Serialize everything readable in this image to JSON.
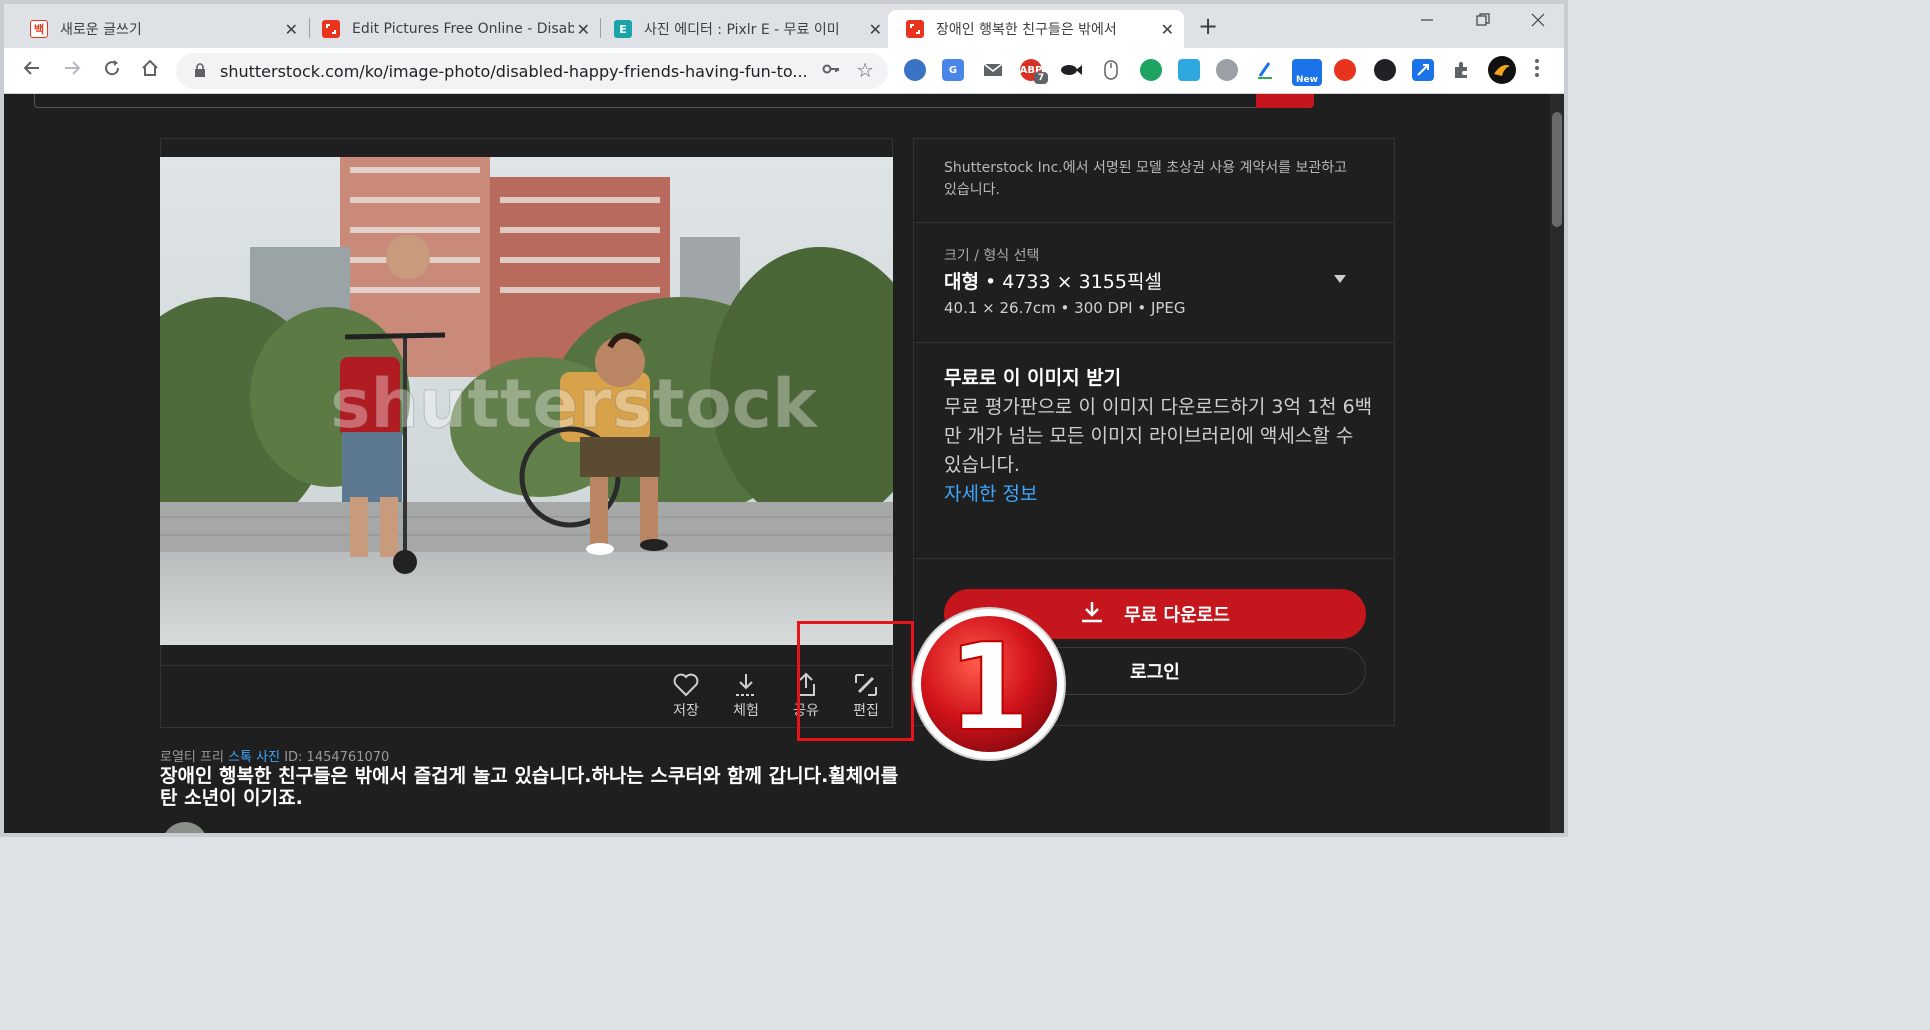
{
  "browser": {
    "tabs": [
      {
        "title": "새로운 글쓰기",
        "favicon_text": "백",
        "favicon_color": "#e8341c"
      },
      {
        "title": "Edit Pictures Free Online - Disab",
        "favicon_text": "",
        "favicon_color": "#e8341c"
      },
      {
        "title": "사진 에디터 : Pixlr E - 무료 이미",
        "favicon_text": "E",
        "favicon_color": "#1aa3a8"
      },
      {
        "title": "장애인 행복한 친구들은 밖에서",
        "favicon_text": "",
        "favicon_color": "#e8341c"
      }
    ],
    "close_glyph": "✕",
    "new_tab_glyph": "+",
    "url": "shutterstock.com/ko/image-photo/disabled-happy-friends-having-fun-to...",
    "extension_badges": {
      "abp_count": "7",
      "new_label": "New"
    }
  },
  "photo": {
    "watermark": "shutterstock"
  },
  "actions": [
    {
      "label": "저장",
      "icon": "heart-icon"
    },
    {
      "label": "체험",
      "icon": "download-icon"
    },
    {
      "label": "공유",
      "icon": "share-icon"
    },
    {
      "label": "편집",
      "icon": "edit-icon"
    }
  ],
  "meta": {
    "prefix": "로열티 프리 ",
    "link": "스톡 사진",
    "id": " ID: 1454761070"
  },
  "image_title": "장애인 행복한 친구들은 밖에서 즐겁게 놀고 있습니다.하나는 스쿠터와 함께 갑니다.휠체어를 탄 소년이 이기죠.",
  "sidebar": {
    "release": "Shutterstock Inc.에서 서명된 모델 초상권 사용 계약서를 보관하고 있습니다.",
    "size_label": "크기 / 형식 선택",
    "size_name": "대형",
    "size_dims": " • 4733 × 3155픽셀",
    "size_sub": "40.1 × 26.7cm • 300 DPI • JPEG",
    "free_heading": "무료로 이 이미지 받기",
    "free_text": "무료 평가판으로 이 이미지 다운로드하기 3억 1천 6백만 개가 넘는 모든 이미지 라이브러리에 액세스할 수 있습니다.",
    "free_link": "자세한 정보",
    "download_button": "무료 다운로드",
    "login_button": "로그인"
  },
  "annotation": {
    "step_number": "1"
  },
  "colors": {
    "accent_red": "#c4161c",
    "link_blue": "#3ea6ff",
    "page_bg": "#1f1f1f"
  }
}
